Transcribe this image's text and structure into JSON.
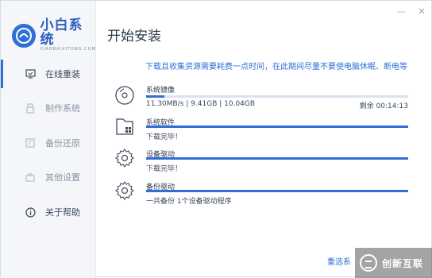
{
  "app": {
    "title": "小白系统",
    "subtitle": "XIAOBAIXITONG.COM"
  },
  "header": {
    "title": "开始安装"
  },
  "window_controls": {
    "minimize": "—",
    "close": "✕"
  },
  "sidebar": {
    "items": [
      {
        "label": "在线重装",
        "icon": "monitor-icon",
        "active": true
      },
      {
        "label": "制作系统",
        "icon": "usb-icon"
      },
      {
        "label": "备份还原",
        "icon": "backup-icon"
      },
      {
        "label": "其他设置",
        "icon": "toolbox-icon"
      },
      {
        "label": "关于帮助",
        "icon": "info-icon"
      }
    ]
  },
  "notice": "下载且收集资源需要耗费一点时间，在此期间尽量不要使电脑休眠、断电等",
  "tasks": [
    {
      "name": "系统镜像",
      "icon": "disc-icon",
      "progress": 0.07,
      "status": "11.30MB/s | 9.41GB | 10.04GB",
      "remaining": "剩余 00:14:13"
    },
    {
      "name": "系统软件",
      "icon": "software-icon",
      "progress": 1.0,
      "status": "下载完毕！"
    },
    {
      "name": "设备驱动",
      "icon": "gear-icon",
      "progress": 1.0,
      "status": "下载完毕！"
    },
    {
      "name": "备份驱动",
      "icon": "gear-icon",
      "progress": 1.0,
      "status": "一共备份 1个设备驱动程序"
    }
  ],
  "footer": {
    "reselect": "重选系",
    "watermark": "创新互联"
  },
  "colors": {
    "accent": "#2f6fd6",
    "track": "#d9e3f2"
  }
}
